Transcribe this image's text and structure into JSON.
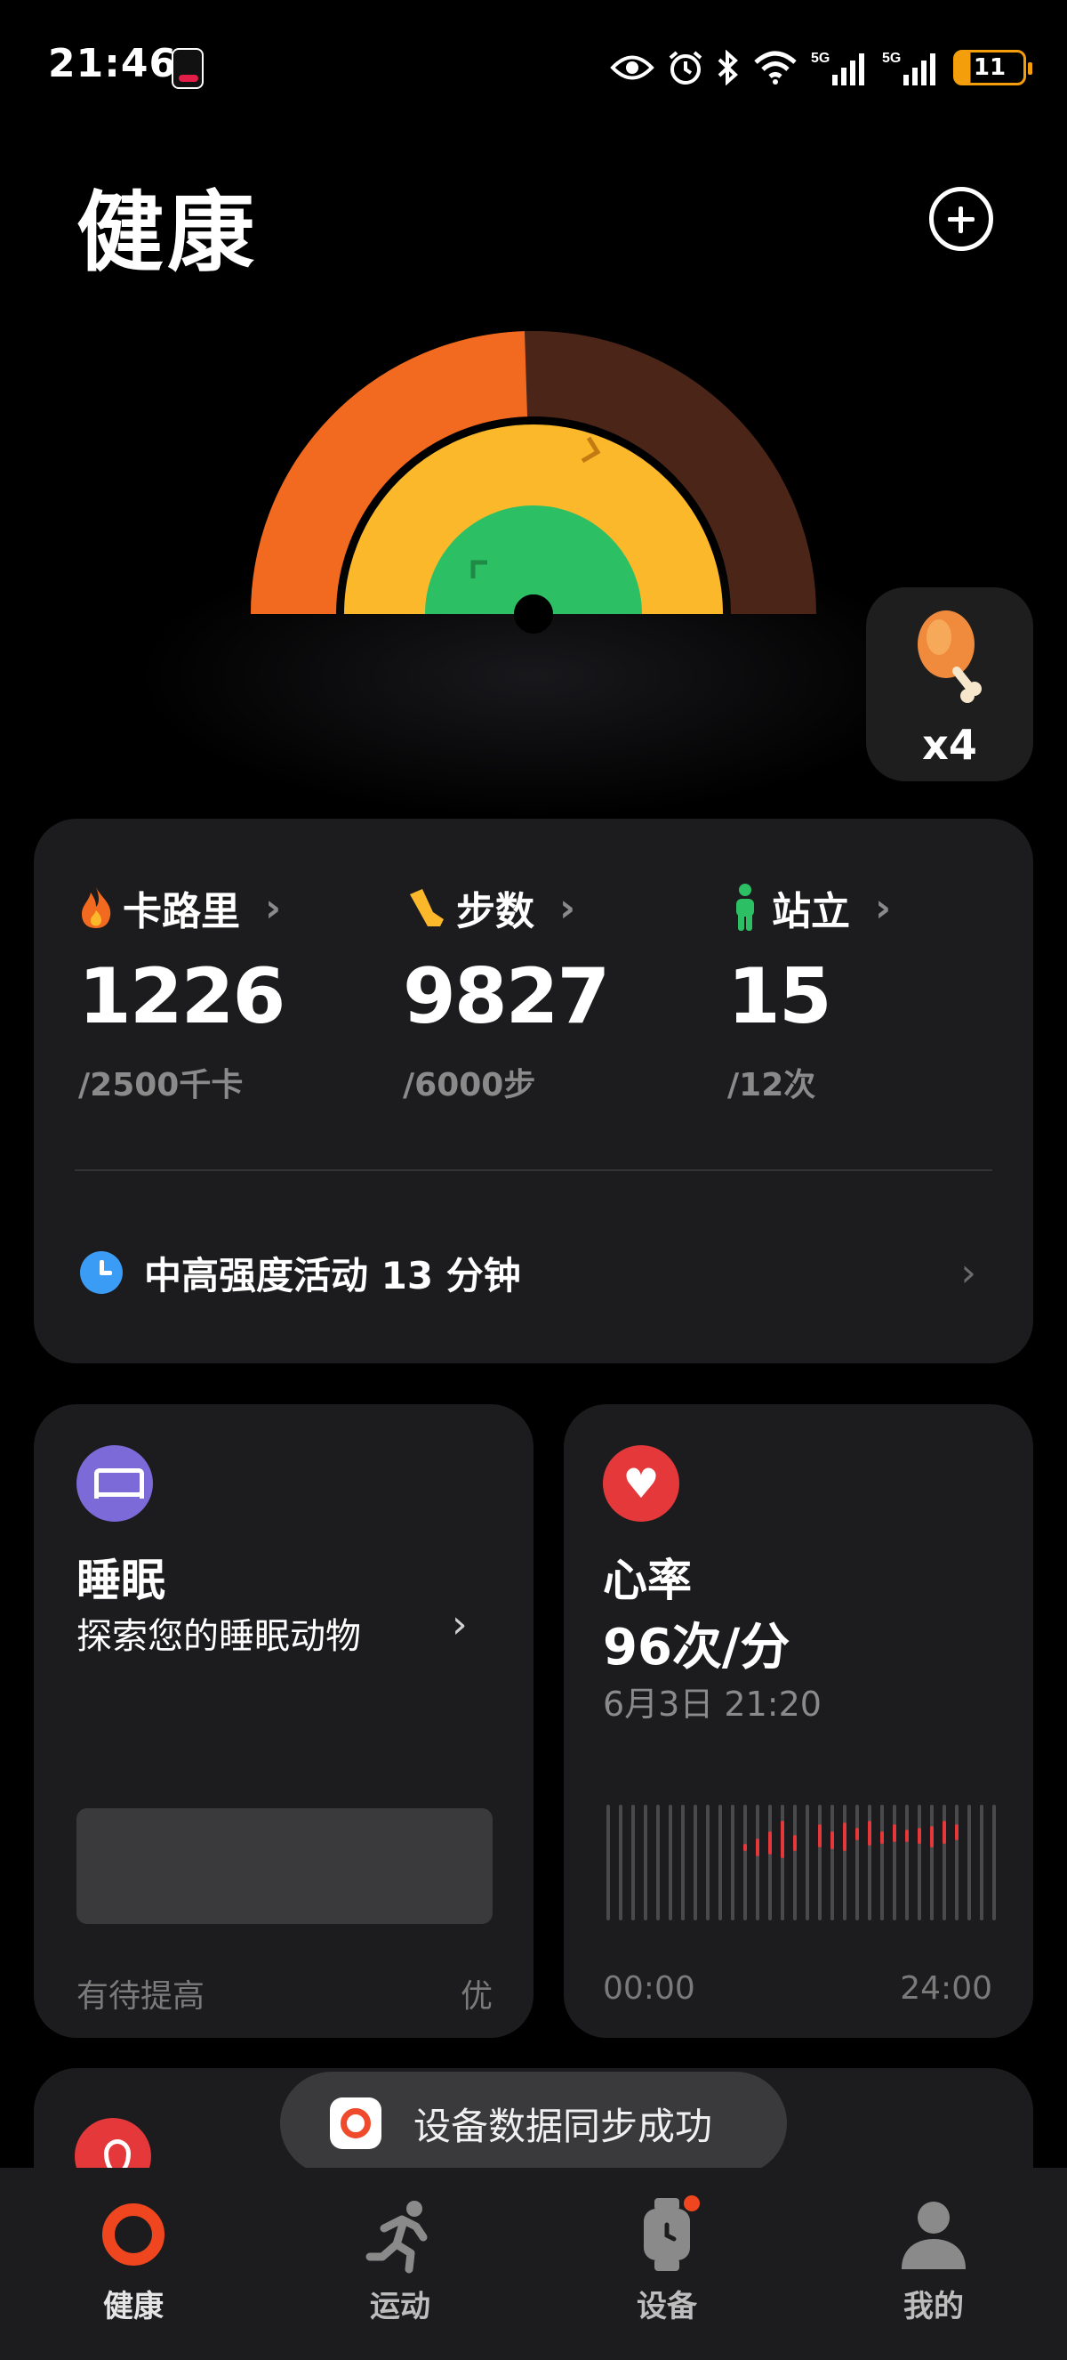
{
  "status_bar": {
    "time": "21:46",
    "battery": "11",
    "icons": [
      "tiktok-icon",
      "eye-icon",
      "alarm-icon",
      "bluetooth-icon",
      "wifi-icon",
      "signal-5g-icon",
      "signal-5g-icon",
      "battery-icon"
    ],
    "network_label_1": "5G",
    "network_label_2": "5G"
  },
  "header": {
    "title": "健康",
    "add_icon": "plus-circle-icon"
  },
  "rings": {
    "outer_color": "#f26a1f",
    "outer_track_color": "#4a2518",
    "middle_color": "#fbb82b",
    "inner_color": "#2dbf63",
    "outer_progress": 0.49,
    "middle_progress": 1.0,
    "inner_progress": 1.0
  },
  "reward": {
    "icon": "drumstick-icon",
    "count": "x4"
  },
  "activity": {
    "metrics": [
      {
        "label": "卡路里",
        "value": "1226",
        "goal": "/2500千卡",
        "icon": "flame-icon",
        "color": "#f26a1f"
      },
      {
        "label": "步数",
        "value": "9827",
        "goal": "/6000步",
        "icon": "shoe-icon",
        "color": "#fbb82b"
      },
      {
        "label": "站立",
        "value": "15",
        "goal": "/12次",
        "icon": "standing-person-icon",
        "color": "#2dbf63"
      }
    ],
    "intensity": "中高强度活动 13 分钟"
  },
  "sleep": {
    "title": "睡眠",
    "subtitle": "探索您的睡眠动物",
    "low_label": "有待提高",
    "high_label": "优",
    "icon": "bed-icon"
  },
  "heart_rate": {
    "title": "心率",
    "value": "96次/分",
    "time": "6月3日 21:20",
    "axis_start": "00:00",
    "axis_end": "24:00",
    "icon": "heart-icon"
  },
  "toast": {
    "text": "设备数据同步成功"
  },
  "nav": {
    "items": [
      {
        "label": "健康",
        "icon": "ring-icon",
        "active": true
      },
      {
        "label": "运动",
        "icon": "running-icon",
        "active": false
      },
      {
        "label": "设备",
        "icon": "watch-icon",
        "active": false
      },
      {
        "label": "我的",
        "icon": "profile-icon",
        "active": false
      }
    ]
  }
}
